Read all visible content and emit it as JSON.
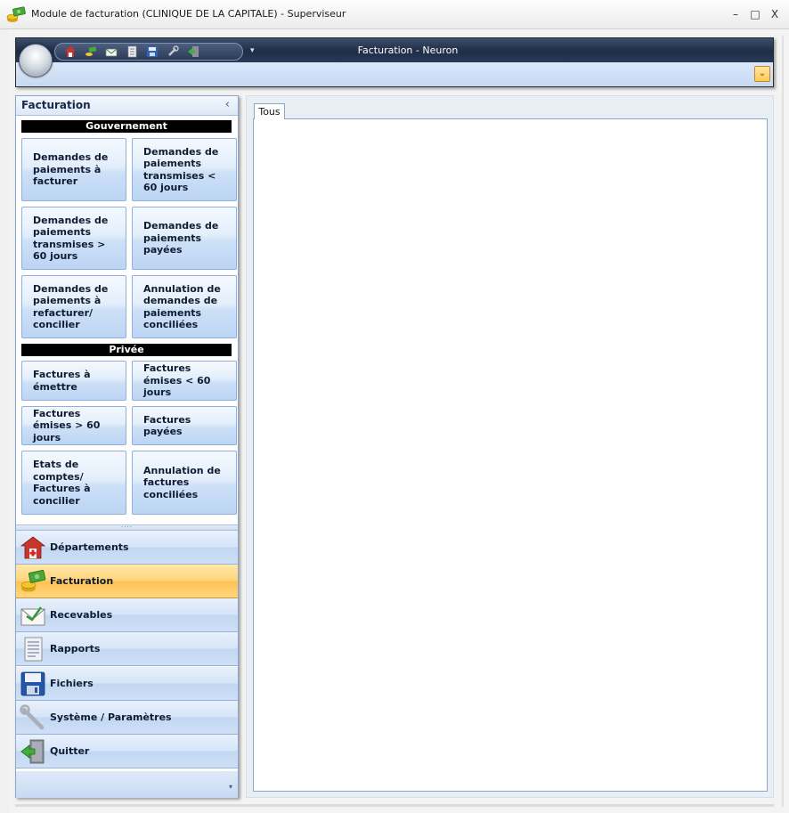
{
  "window": {
    "title": "Module de facturation (CLINIQUE DE LA CAPITALE) - Superviseur",
    "controls": {
      "minimize": "–",
      "maximize": "□",
      "close": "X"
    }
  },
  "ribbon": {
    "title": "Facturation - Neuron",
    "qat_more": "▾",
    "expand_glyph": "⌄"
  },
  "nav_pane": {
    "header": "Facturation",
    "collapse_glyph": "‹",
    "splitter_grip": "····",
    "sections": [
      {
        "title": "Gouvernement",
        "tiles": [
          "Demandes de paiements à facturer",
          "Demandes de paiements transmises < 60 jours",
          "Demandes de paiements transmises > 60 jours",
          "Demandes de paiements payées",
          "Demandes de paiements à refacturer/ concilier",
          "Annulation de demandes de paiements conciliées"
        ]
      },
      {
        "title": "Privée",
        "tiles": [
          "Factures à émettre",
          "Factures émises < 60 jours",
          "Factures émises > 60 jours",
          "Factures payées",
          "Etats de comptes/ Factures à concilier",
          "Annulation de factures conciliées"
        ]
      }
    ],
    "buttons": [
      {
        "label": "Départements",
        "icon": "departments-icon",
        "active": false
      },
      {
        "label": "Facturation",
        "icon": "billing-icon",
        "active": true
      },
      {
        "label": "Recevables",
        "icon": "receivables-icon",
        "active": false
      },
      {
        "label": "Rapports",
        "icon": "reports-icon",
        "active": false
      },
      {
        "label": "Fichiers",
        "icon": "floppy-disk-icon",
        "active": false
      },
      {
        "label": "Système / Paramètres",
        "icon": "wrench-icon",
        "active": false
      },
      {
        "label": "Quitter",
        "icon": "exit-door-icon",
        "active": false
      }
    ],
    "footer_glyph": "▾"
  },
  "main": {
    "tabs": [
      {
        "label": "Tous",
        "selected": true
      }
    ]
  },
  "colors": {
    "ribbon_dark": "#1f2d45",
    "nav_active": "#ffc254",
    "tile_blue": "#cde0f7",
    "section_bar": "#000000"
  }
}
